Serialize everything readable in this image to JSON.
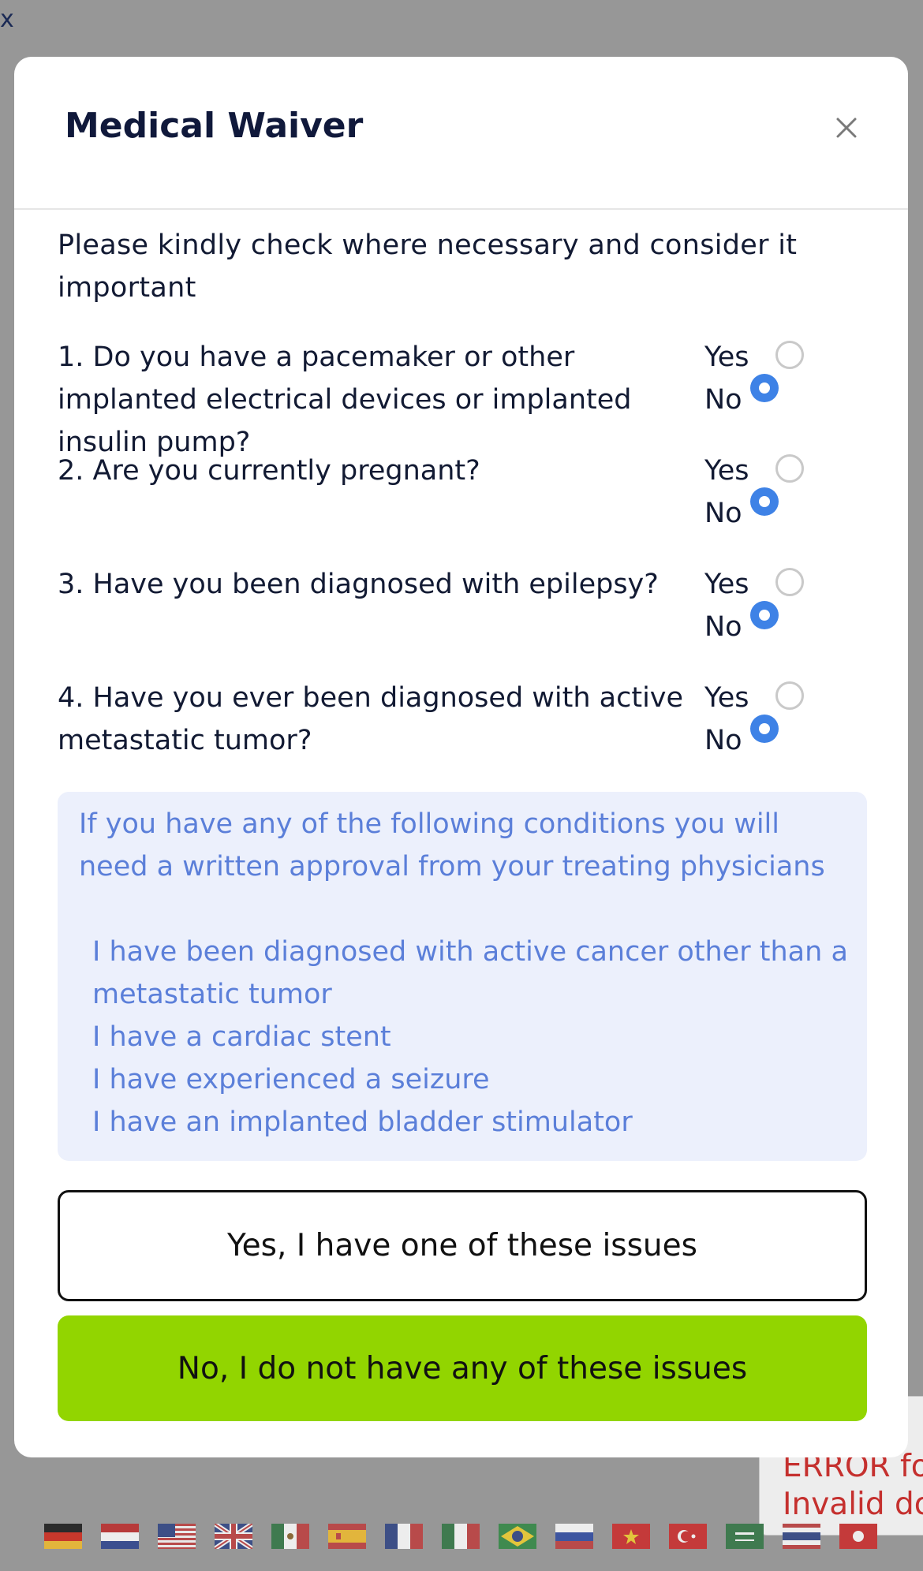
{
  "background": {
    "corner_close_label": "x",
    "error_lines": [
      "ERROR fo",
      "Invalid do"
    ],
    "flags": [
      {
        "icon": "germany-flag-icon"
      },
      {
        "icon": "netherlands-flag-icon"
      },
      {
        "icon": "usa-flag-icon"
      },
      {
        "icon": "uk-flag-icon"
      },
      {
        "icon": "mexico-flag-icon"
      },
      {
        "icon": "spain-flag-icon"
      },
      {
        "icon": "france-flag-icon"
      },
      {
        "icon": "italy-flag-icon"
      },
      {
        "icon": "brazil-flag-icon"
      },
      {
        "icon": "russia-flag-icon"
      },
      {
        "icon": "vietnam-flag-icon"
      },
      {
        "icon": "turkey-flag-icon"
      },
      {
        "icon": "saudi-arabia-flag-icon"
      },
      {
        "icon": "thailand-flag-icon"
      },
      {
        "icon": "japan-flag-icon"
      }
    ]
  },
  "modal": {
    "title": "Medical Waiver",
    "close_icon": "close-icon",
    "intro": "Please kindly check where necessary and consider it important",
    "yes_label": "Yes",
    "no_label": "No",
    "questions": [
      {
        "text": "1. Do you have a pacemaker or other implanted electrical devices or implanted insulin pump?",
        "selected": "No"
      },
      {
        "text": "2. Are you currently pregnant?",
        "selected": "No"
      },
      {
        "text": "3. Have you been diagnosed with epilepsy?",
        "selected": "No"
      },
      {
        "text": "4. Have you ever been diagnosed with active metastatic tumor?",
        "selected": "No"
      }
    ],
    "info": {
      "text": "If you have any of the following conditions you will need a written approval from your treating physicians",
      "items": [
        "I have been diagnosed with active cancer other than a metastatic tumor",
        "I have a cardiac stent",
        "I have experienced a seizure",
        "I have an implanted bladder stimulator"
      ]
    },
    "buttons": {
      "yes": "Yes, I have one of these issues",
      "no": "No, I do not have any of these issues"
    },
    "colors": {
      "accent_green": "#92d500",
      "radio_blue": "#3e82e6",
      "info_text": "#5b7fd9",
      "info_bg": "#ecf0fc",
      "overlay": "#979797"
    }
  }
}
